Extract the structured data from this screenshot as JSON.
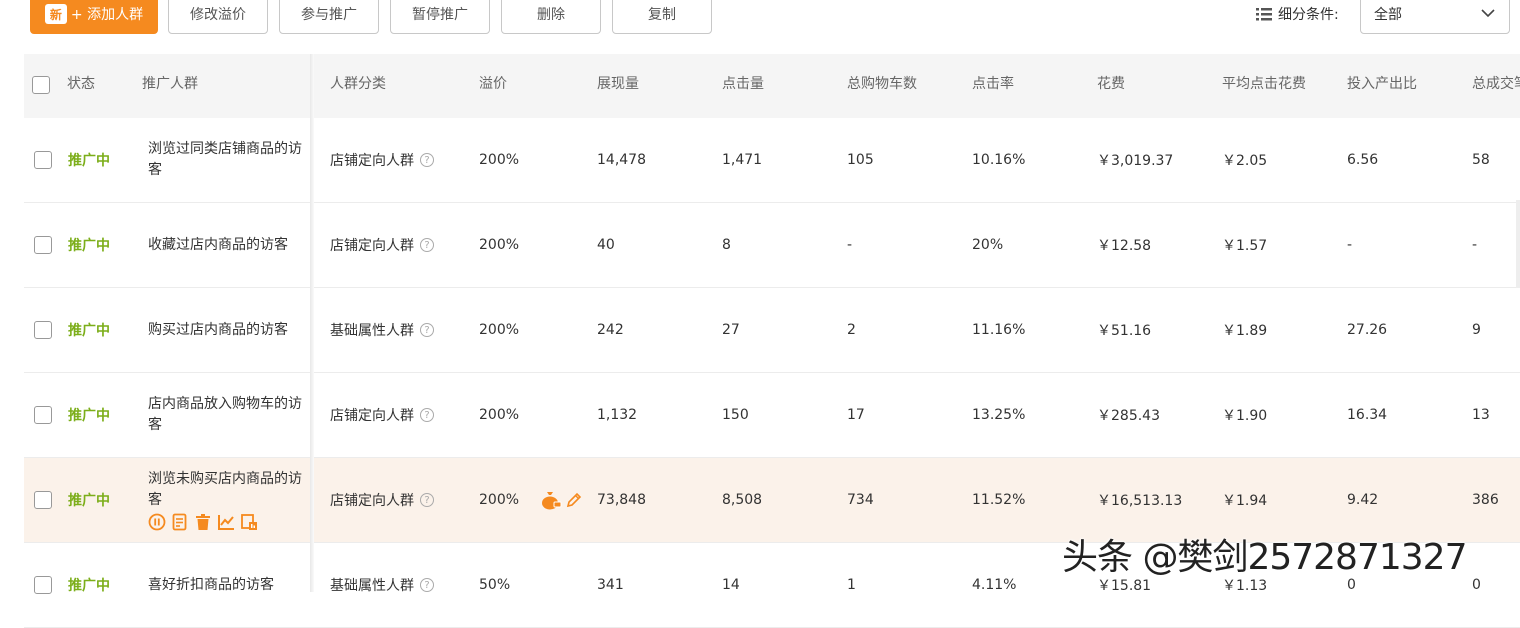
{
  "toolbar": {
    "new_badge": "新",
    "add_label": "+ 添加人群",
    "edit_premium": "修改溢价",
    "join_promo": "参与推广",
    "pause_promo": "暂停推广",
    "delete": "删除",
    "copy": "复制",
    "filter_label": "细分条件:",
    "filter_value": "全部"
  },
  "table": {
    "headers": [
      "状态",
      "推广人群",
      "人群分类",
      "溢价",
      "展现量",
      "点击量",
      "总购物车数",
      "点击率",
      "花费",
      "平均点击花费",
      "投入产出比",
      "总成交笔"
    ],
    "rows": [
      {
        "status": "推广中",
        "name": "浏览过同类店铺商品的访客",
        "category": "店铺定向人群",
        "premium": "200%",
        "impressions": "14,478",
        "clicks": "1,471",
        "cart": "105",
        "ctr": "10.16%",
        "cost": "￥3,019.37",
        "cpc": "￥2.05",
        "roi": "6.56",
        "orders": "58"
      },
      {
        "status": "推广中",
        "name": "收藏过店内商品的访客",
        "category": "店铺定向人群",
        "premium": "200%",
        "impressions": "40",
        "clicks": "8",
        "cart": "-",
        "ctr": "20%",
        "cost": "￥12.58",
        "cpc": "￥1.57",
        "roi": "-",
        "orders": "-"
      },
      {
        "status": "推广中",
        "name": "购买过店内商品的访客",
        "category": "基础属性人群",
        "premium": "200%",
        "impressions": "242",
        "clicks": "27",
        "cart": "2",
        "ctr": "11.16%",
        "cost": "￥51.16",
        "cpc": "￥1.89",
        "roi": "27.26",
        "orders": "9"
      },
      {
        "status": "推广中",
        "name": "店内商品放入购物车的访客",
        "category": "店铺定向人群",
        "premium": "200%",
        "impressions": "1,132",
        "clicks": "150",
        "cart": "17",
        "ctr": "13.25%",
        "cost": "￥285.43",
        "cpc": "￥1.90",
        "roi": "16.34",
        "orders": "13"
      },
      {
        "status": "推广中",
        "name": "浏览未购买店内商品的访客",
        "category": "店铺定向人群",
        "premium": "200%",
        "impressions": "73,848",
        "clicks": "8,508",
        "cart": "734",
        "ctr": "11.52%",
        "cost": "￥16,513.13",
        "cpc": "￥1.94",
        "roi": "9.42",
        "orders": "386"
      },
      {
        "status": "推广中",
        "name": "喜好折扣商品的访客",
        "category": "基础属性人群",
        "premium": "50%",
        "impressions": "341",
        "clicks": "14",
        "cart": "1",
        "ctr": "4.11%",
        "cost": "￥15.81",
        "cpc": "￥1.13",
        "roi": "0",
        "orders": "0"
      }
    ]
  },
  "help_glyph": "?",
  "watermark": "头条 @樊剑2572871327",
  "colors": {
    "accent": "#f58a1f",
    "status_green": "#7cae1a",
    "highlight_row": "#fbf2ea"
  }
}
